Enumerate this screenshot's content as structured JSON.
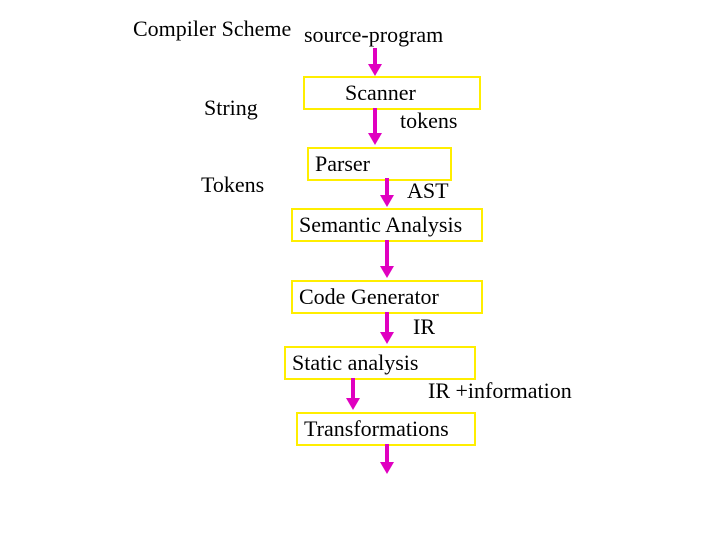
{
  "title": "Compiler Scheme",
  "input_label": "source-program",
  "side_labels": {
    "string": "String",
    "tokens": "Tokens"
  },
  "stages": {
    "scanner": "Scanner",
    "parser": "Parser",
    "semantic": "Semantic Analysis",
    "codegen": "Code Generator",
    "static": "Static analysis",
    "transform": "Transformations"
  },
  "edge_labels": {
    "tokens": "tokens",
    "ast": "AST",
    "ir": "IR",
    "ir_info": "IR +information"
  }
}
